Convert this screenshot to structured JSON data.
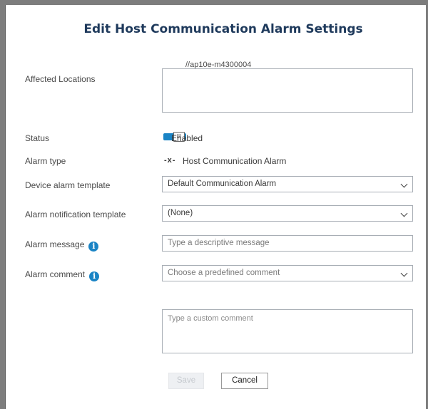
{
  "dialog": {
    "title": "Edit Host Communication Alarm Settings",
    "host_path": "//ap10e-m4300004"
  },
  "fields": {
    "affected_locations": {
      "label": "Affected Locations",
      "value": ""
    },
    "status": {
      "label": "Status",
      "toggle_text": "Enabled",
      "thumb_glyph": "III",
      "enabled": true
    },
    "alarm_type": {
      "label": "Alarm type",
      "icon_glyph": "-x-",
      "icon": "disconnected-link-icon",
      "value": "Host Communication Alarm"
    },
    "device_alarm_template": {
      "label": "Device alarm template",
      "selected": "Default Communication Alarm"
    },
    "alarm_notification_template": {
      "label": "Alarm notification template",
      "selected": "(None)"
    },
    "alarm_message": {
      "label": "Alarm message",
      "info_glyph": "i",
      "placeholder": "Type a descriptive message"
    },
    "alarm_comment": {
      "label": "Alarm comment",
      "info_glyph": "i",
      "placeholder": "Choose a predefined comment"
    },
    "custom_comment": {
      "placeholder": "Type a custom comment"
    }
  },
  "buttons": {
    "save": "Save",
    "cancel": "Cancel"
  },
  "colors": {
    "accent": "#1a84c5",
    "title": "#1f3a5c",
    "border": "#a8aeb5"
  }
}
